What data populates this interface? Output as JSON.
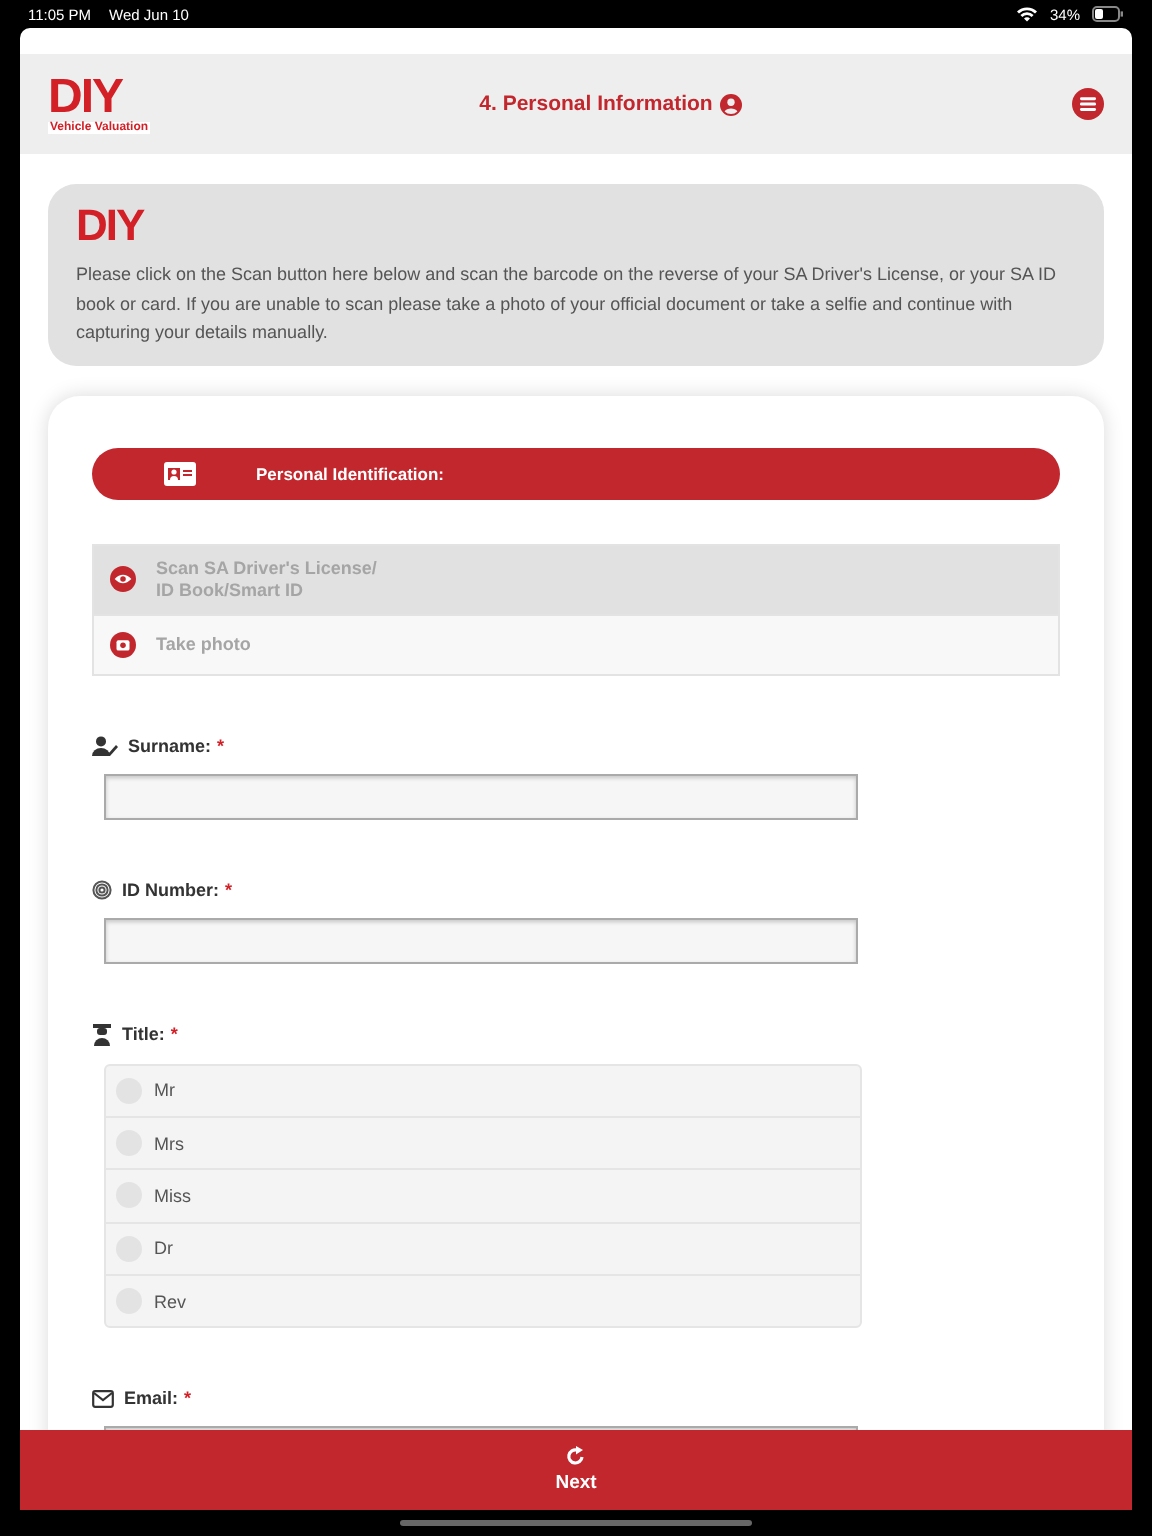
{
  "status_bar": {
    "time": "11:05 PM",
    "date": "Wed Jun 10",
    "battery": "34%"
  },
  "header": {
    "logo": {
      "letters": "DIY",
      "tagline": "Vehicle Valuation"
    },
    "title": "4. Personal Information"
  },
  "intro": {
    "logo": {
      "letters": "DIY"
    },
    "text": "Please click on the Scan button here below and scan the barcode on the reverse of your SA Driver's License, or your SA ID book or card. If you are unable to scan please take a photo of your official document or take a selfie and continue with capturing your details manually."
  },
  "section": {
    "title": "Personal Identification:"
  },
  "options": [
    {
      "kind": "scan",
      "label": "Scan SA Driver's License/\nID Book/Smart ID",
      "selected": true
    },
    {
      "kind": "photo",
      "label": "Take photo",
      "selected": false
    }
  ],
  "fields": [
    {
      "kind": "text",
      "label": "Surname:",
      "required": "*"
    },
    {
      "kind": "text",
      "label": "ID Number:",
      "required": "*"
    },
    {
      "kind": "radio",
      "label": "Title:",
      "required": "*",
      "choices": [
        {
          "label": "Mr",
          "selected": false
        },
        {
          "label": "Mrs",
          "selected": false
        },
        {
          "label": "Miss",
          "selected": false
        },
        {
          "label": "Dr",
          "selected": false
        },
        {
          "label": "Rev",
          "selected": false
        }
      ]
    },
    {
      "kind": "text",
      "label": "Email:",
      "required": "*"
    }
  ],
  "footer": {
    "button": "Next"
  }
}
